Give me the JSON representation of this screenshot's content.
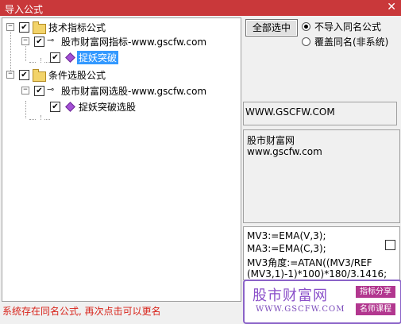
{
  "window": {
    "title": "导入公式",
    "close": "✕"
  },
  "tree": {
    "nodes": [
      {
        "label": "技术指标公式",
        "checked": true
      },
      {
        "label": "股市财富网指标-www.gscfw.com",
        "checked": true
      },
      {
        "label": "捉妖突破",
        "checked": true,
        "selected": true
      },
      {
        "label": "条件选股公式",
        "checked": true
      },
      {
        "label": "股市财富网选股-www.gscfw.com",
        "checked": true
      },
      {
        "label": "捉妖突破选股",
        "checked": true
      }
    ]
  },
  "options": {
    "select_all_label": "全部选中",
    "radio1": "不导入同名公式",
    "radio2": "覆盖同名(非系统)"
  },
  "site_box": {
    "text": "WWW.GSCFW.COM"
  },
  "desc_box": {
    "line1": "股市财富网",
    "line2": "www.gscfw.com"
  },
  "code_box": {
    "lines": [
      "MV3:=EMA(V,3);",
      "MA3:=EMA(C,3);",
      "MV3角度:=ATAN((MV3/REF",
      "(MV3,1)-1)*100)*180/3.1416;"
    ]
  },
  "status": "系统存在同名公式, 再次点击可以更名",
  "watermark": {
    "title": "股市财富网",
    "url": "WWW.GSCFW.COM",
    "tag1": "指标分享",
    "tag2": "名师课程"
  }
}
